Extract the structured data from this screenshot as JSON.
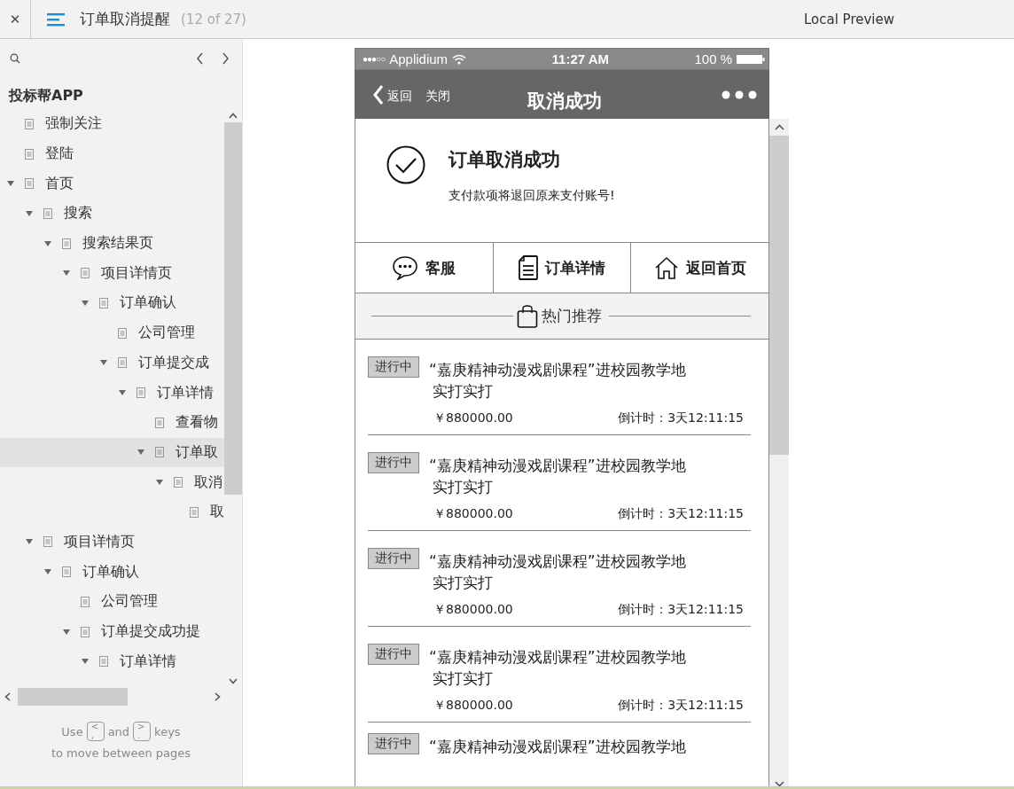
{
  "top_bar": {
    "close": "✕",
    "page_title": "订单取消提醒",
    "page_count": "(12 of 27)",
    "preview_label": "Local Preview"
  },
  "sidebar": {
    "project_title": "投标帮APP",
    "tree": [
      {
        "label": "强制关注",
        "selected": false
      },
      {
        "label": "登陆",
        "selected": false
      },
      {
        "label": "首页",
        "selected": false,
        "expanded": true,
        "children": [
          {
            "label": "搜索",
            "selected": false,
            "expanded": true,
            "children": [
              {
                "label": "搜索结果页",
                "selected": false,
                "expanded": true,
                "children": [
                  {
                    "label": "项目详情页",
                    "selected": false,
                    "expanded": true,
                    "children": [
                      {
                        "label": "订单确认",
                        "selected": false,
                        "expanded": true,
                        "children": [
                          {
                            "label": "公司管理",
                            "selected": false
                          },
                          {
                            "label": "订单提交成",
                            "selected": false,
                            "expanded": true,
                            "children": [
                              {
                                "label": "订单详情",
                                "selected": false,
                                "expanded": true,
                                "children": [
                                  {
                                    "label": "查看物",
                                    "selected": false
                                  },
                                  {
                                    "label": "订单取",
                                    "selected": true,
                                    "expanded": true,
                                    "children": [
                                      {
                                        "label": "取消",
                                        "selected": false,
                                        "expanded": true,
                                        "children": [
                                          {
                                            "label": "取",
                                            "selected": false
                                          }
                                        ]
                                      }
                                    ]
                                  }
                                ]
                              }
                            ]
                          }
                        ]
                      }
                    ]
                  }
                ]
              }
            ]
          },
          {
            "label": "项目详情页",
            "selected": false,
            "expanded": true,
            "children": [
              {
                "label": "订单确认",
                "selected": false,
                "expanded": true,
                "children": [
                  {
                    "label": "公司管理",
                    "selected": false
                  },
                  {
                    "label": "订单提交成功提",
                    "selected": false,
                    "expanded": true,
                    "children": [
                      {
                        "label": "订单详情",
                        "selected": false,
                        "expanded": true
                      }
                    ]
                  }
                ]
              }
            ]
          }
        ]
      }
    ],
    "hint": {
      "use": "Use",
      "key_prev_top": "<",
      "key_prev_bottom": ",",
      "and": "and",
      "key_next_top": ">",
      "key_next_bottom": ".",
      "keys": "keys",
      "line2": "to move between pages"
    }
  },
  "phone": {
    "status_bar": {
      "signal": "●●●○○",
      "carrier": "Applidium",
      "time": "11:27 AM",
      "battery": "100 %"
    },
    "nav": {
      "back": "返回",
      "close": "关闭",
      "title": "取消成功"
    },
    "success": {
      "title": "订单取消成功",
      "message": "支付款项将退回原来支付账号!"
    },
    "actions": [
      {
        "kind": "chat",
        "label": "客服"
      },
      {
        "kind": "document",
        "label": "订单详情"
      },
      {
        "kind": "home",
        "label": "返回首页"
      }
    ],
    "section_title": "热门推荐",
    "products": [
      {
        "tag": "进行中",
        "title_lines": [
          "“嘉庚精神动漫戏剧课程”进校园教学地",
          "实打实打"
        ],
        "price": "￥880000.00",
        "countdown": "倒计时：3天12:11:15"
      },
      {
        "tag": "进行中",
        "title_lines": [
          "“嘉庚精神动漫戏剧课程”进校园教学地",
          "实打实打"
        ],
        "price": "￥880000.00",
        "countdown": "倒计时：3天12:11:15"
      },
      {
        "tag": "进行中",
        "title_lines": [
          "“嘉庚精神动漫戏剧课程”进校园教学地",
          "实打实打"
        ],
        "price": "￥880000.00",
        "countdown": "倒计时：3天12:11:15"
      },
      {
        "tag": "进行中",
        "title_lines": [
          "“嘉庚精神动漫戏剧课程”进校园教学地",
          "实打实打"
        ],
        "price": "￥880000.00",
        "countdown": "倒计时：3天12:11:15"
      },
      {
        "tag": "进行中",
        "title_lines": [
          "“嘉庚精神动漫戏剧课程”进校园教学地"
        ]
      }
    ]
  }
}
